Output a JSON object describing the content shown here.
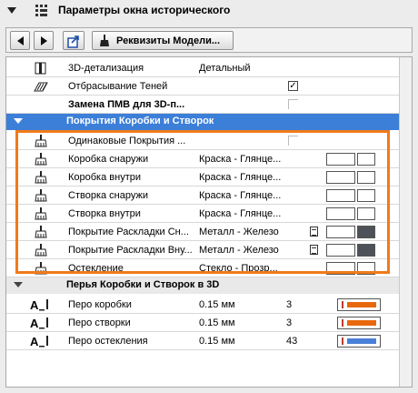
{
  "window": {
    "title": "Параметры окна исторического"
  },
  "toolbar": {
    "properties_label": "Реквизиты Модели..."
  },
  "colors": {
    "highlight": "#3c7fd9",
    "frame": "#f07a1a",
    "pen_orange": "#e8680c",
    "pen_blue": "#4a7fd8"
  },
  "rows_top": [
    {
      "label": "3D-детализация",
      "value": "Детальный",
      "icon": "3d-detail-icon"
    },
    {
      "label": "Отбрасывание Теней",
      "value": "",
      "icon": "shadow-icon",
      "checked": true
    },
    {
      "label": "Замена ПМВ для 3D-п...",
      "value": "",
      "icon": "",
      "bold": true,
      "checked": false
    }
  ],
  "section_surfaces": {
    "label": "Покрытия Коробки и Створок"
  },
  "surface_rows": [
    {
      "label": "Одинаковые Покрытия ...",
      "value": "",
      "checkbox": true
    },
    {
      "label": "Коробка снаружи",
      "value": "Краска - Глянце..."
    },
    {
      "label": "Коробка внутри",
      "value": "Краска - Глянце..."
    },
    {
      "label": "Створка снаружи",
      "value": "Краска - Глянце..."
    },
    {
      "label": "Створка внутри",
      "value": "Краска - Глянце..."
    },
    {
      "label": "Покрытие Раскладки Сн...",
      "value": "Металл - Железо",
      "dark": true
    },
    {
      "label": "Покрытие Раскладки Вну...",
      "value": "Металл - Железо",
      "dark": true
    },
    {
      "label": "Остекление",
      "value": "Стекло - Прозр..."
    }
  ],
  "section_pens": {
    "label": "Перья Коробки и Створок в 3D"
  },
  "pen_rows": [
    {
      "label": "Перо коробки",
      "value": "0.15 мм",
      "number": "3",
      "color": "#e8680c"
    },
    {
      "label": "Перо створки",
      "value": "0.15 мм",
      "number": "3",
      "color": "#e8680c"
    },
    {
      "label": "Перо остекления",
      "value": "0.15 мм",
      "number": "43",
      "color": "#4a7fd8"
    }
  ]
}
